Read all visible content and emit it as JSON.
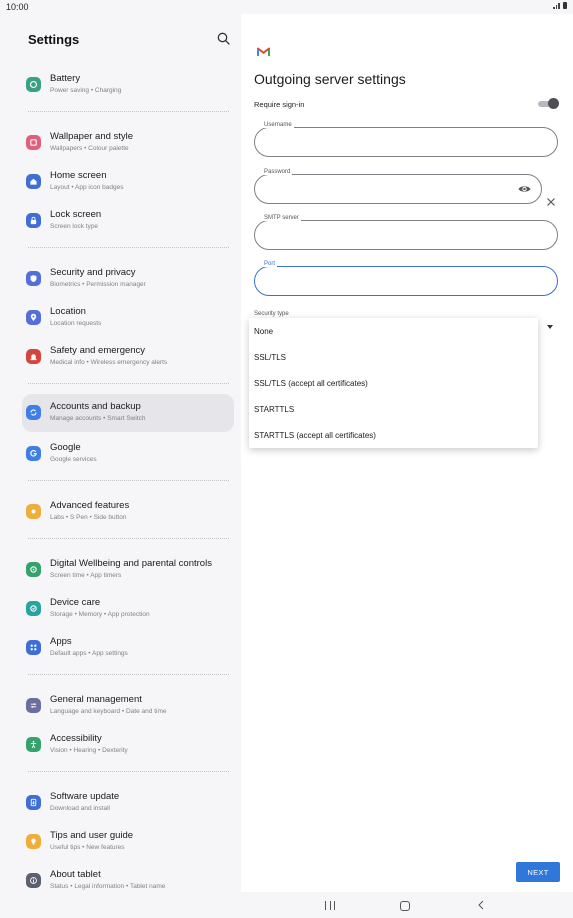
{
  "status_bar": {
    "time": "10:00"
  },
  "settings": {
    "title": "Settings",
    "items": [
      {
        "label": "Battery",
        "sub": "Power saving  •  Charging",
        "icon": "battery-icon",
        "color": "#3aa17e"
      },
      {
        "label": "Wallpaper and style",
        "sub": "Wallpapers  •  Colour palette",
        "icon": "wallpaper-icon",
        "color": "#e25f7b"
      },
      {
        "label": "Home screen",
        "sub": "Layout  •  App icon badges",
        "icon": "home-icon",
        "color": "#3f6fd6"
      },
      {
        "label": "Lock screen",
        "sub": "Screen lock type",
        "icon": "lock-icon",
        "color": "#3f6fd6"
      },
      {
        "label": "Security and privacy",
        "sub": "Biometrics  •  Permission manager",
        "icon": "shield-icon",
        "color": "#5470d8"
      },
      {
        "label": "Location",
        "sub": "Location requests",
        "icon": "location-icon",
        "color": "#5470d8"
      },
      {
        "label": "Safety and emergency",
        "sub": "Medical info  •  Wireless emergency alerts",
        "icon": "emergency-icon",
        "color": "#d4463d"
      },
      {
        "label": "Accounts and backup",
        "sub": "Manage accounts  •  Smart Switch",
        "icon": "sync-icon",
        "color": "#3f7ee6"
      },
      {
        "label": "Google",
        "sub": "Google services",
        "icon": "google-icon",
        "color": "#3f7ee6"
      },
      {
        "label": "Advanced features",
        "sub": "Labs  •  S Pen  •  Side button",
        "icon": "star-gear-icon",
        "color": "#f0ad3a"
      },
      {
        "label": "Digital Wellbeing and parental controls",
        "sub": "Screen time  •  App timers",
        "icon": "wellbeing-icon",
        "color": "#33a36b"
      },
      {
        "label": "Device care",
        "sub": "Storage  •  Memory  •  App protection",
        "icon": "device-care-icon",
        "color": "#2aa3a0"
      },
      {
        "label": "Apps",
        "sub": "Default apps  •  App settings",
        "icon": "apps-icon",
        "color": "#3f6fd6"
      },
      {
        "label": "General management",
        "sub": "Language and keyboard  •  Date and time",
        "icon": "sliders-icon",
        "color": "#6a6f9e"
      },
      {
        "label": "Accessibility",
        "sub": "Vision  •  Hearing  •  Dexterity",
        "icon": "accessibility-icon",
        "color": "#33a36b"
      },
      {
        "label": "Software update",
        "sub": "Download and install",
        "icon": "update-icon",
        "color": "#3f6fd6"
      },
      {
        "label": "Tips and user guide",
        "sub": "Useful tips  •  New features",
        "icon": "bulb-icon",
        "color": "#f0ad3a"
      },
      {
        "label": "About tablet",
        "sub": "Status  •  Legal information  •  Tablet name",
        "icon": "info-icon",
        "color": "#5d6072"
      }
    ],
    "active_item": "Accounts and backup"
  },
  "server": {
    "title": "Outgoing server settings",
    "require_signin_label": "Require sign-in",
    "require_signin_on": true,
    "username_label": "Username",
    "password_label": "Password",
    "smtp_label": "SMTP server",
    "port_label": "Port",
    "security_type_label": "Security type",
    "security_options": [
      "None",
      "SSL/TLS",
      "SSL/TLS (accept all certificates)",
      "STARTTLS",
      "STARTTLS (accept all certificates)"
    ],
    "next_label": "NEXT"
  },
  "colors": {
    "accent": "#2f77d9",
    "focus": "#3a70c8"
  }
}
